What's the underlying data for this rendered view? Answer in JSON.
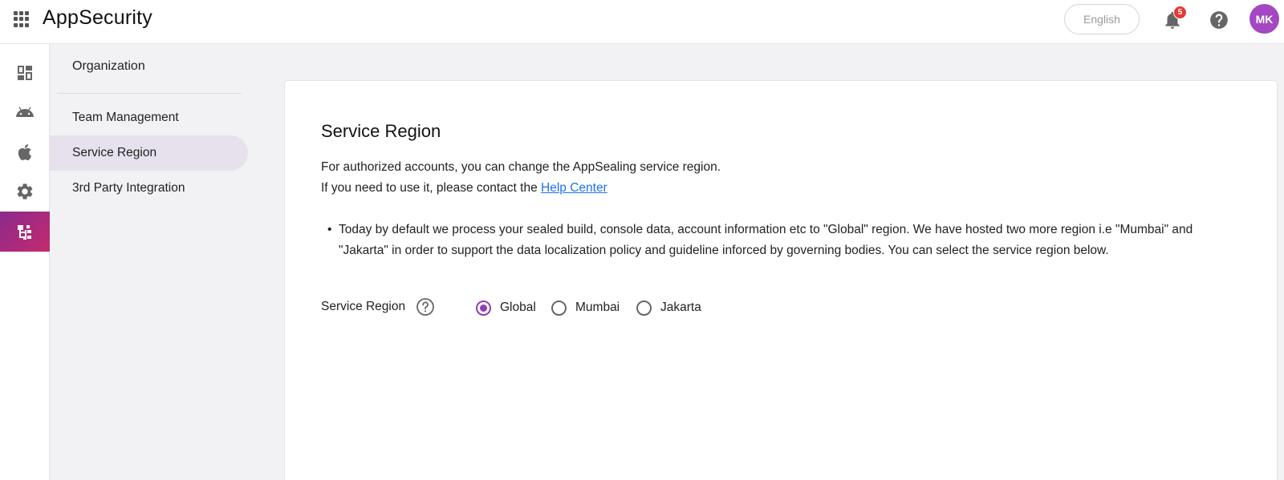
{
  "header": {
    "brand": "AppSecurity",
    "language": "English",
    "notification_count": "5",
    "avatar_initials": "MK"
  },
  "rail": {
    "items": [
      {
        "icon": "dashboard-icon"
      },
      {
        "icon": "android-icon"
      },
      {
        "icon": "apple-icon"
      },
      {
        "icon": "gear-icon"
      },
      {
        "icon": "organization-icon",
        "active": true
      }
    ],
    "active_color": "#a0297d"
  },
  "subnav": {
    "heading": "Organization",
    "items": [
      {
        "label": "Team Management"
      },
      {
        "label": "Service Region",
        "selected": true
      },
      {
        "label": "3rd Party Integration"
      }
    ]
  },
  "main": {
    "title": "Service Region",
    "desc_line1": "For authorized accounts, you can change the AppSealing service region.",
    "desc_line2_prefix": "If you need to use it, please contact the ",
    "help_link": "Help Center",
    "bullet": "Today by default we process your sealed build, console data, account information etc to \"Global\" region. We have hosted two more region i.e \"Mumbai\" and \"Jakarta\" in order to support the data localization policy and guideline inforced by governing bodies. You can select the service region below.",
    "region_label": "Service Region",
    "options": [
      {
        "label": "Global",
        "checked": true
      },
      {
        "label": "Mumbai",
        "checked": false
      },
      {
        "label": "Jakarta",
        "checked": false
      }
    ],
    "accent_color": "#8e3fae"
  }
}
